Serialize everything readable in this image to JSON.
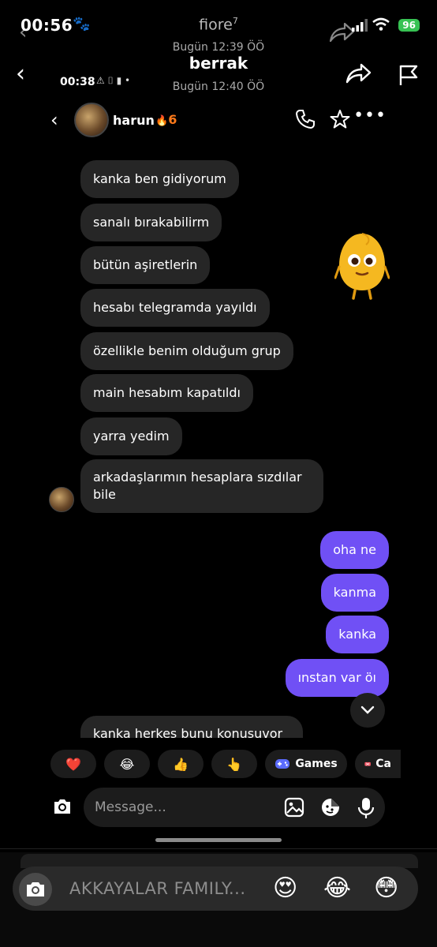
{
  "outer_status": {
    "time": "00:56",
    "paw_icon": "🐾",
    "app_name": "fiore",
    "app_sup": "7",
    "sub_time": "Bugün 12:39 ÖÖ",
    "battery": "96"
  },
  "story_header": {
    "title": "berrak",
    "subtitle": "Bugün 12:40 ÖÖ"
  },
  "inner_status": {
    "time": "00:38",
    "icons": "⚠ ⌷ ▮ •"
  },
  "chat": {
    "contact_name": "harun",
    "streak_icon": "🔥",
    "streak": "6",
    "more_icon": "•••"
  },
  "messages": [
    {
      "text": "kanka ben gidiyorum",
      "side": "left"
    },
    {
      "text": "sanalı bırakabilirm",
      "side": "left"
    },
    {
      "text": "bütün aşiretlerin",
      "side": "left"
    },
    {
      "text": "hesabı telegramda yayıldı",
      "side": "left"
    },
    {
      "text": "özellikle benim olduğum grup",
      "side": "left"
    },
    {
      "text": "main hesabım kapatıldı",
      "side": "left"
    },
    {
      "text": "yarra yedim",
      "side": "left"
    },
    {
      "text": "arkadaşlarımın hesaplara sızdılar bile",
      "side": "left"
    },
    {
      "text": "oha ne",
      "side": "right"
    },
    {
      "text": "kanma",
      "side": "right"
    },
    {
      "text": "kanka",
      "side": "right"
    },
    {
      "text": "ınstan var öı",
      "side": "right"
    },
    {
      "text": "kanka herkes bunu konusuvor",
      "side": "left"
    }
  ],
  "quick_reactions": [
    "❤️",
    "😂",
    "👍",
    "👆"
  ],
  "chips": {
    "games_label": "Games",
    "cut_label": "Ca"
  },
  "composer": {
    "placeholder": "Message..."
  },
  "outer_reply": {
    "placeholder": "AKKAYALAR FAMILY...",
    "emojis": [
      "😍",
      "😂",
      "😳"
    ]
  },
  "colors": {
    "accent_purple": "#7050f5",
    "bubble_gray": "#262626",
    "streak_orange": "#ff7a1a",
    "battery_green": "#37c253"
  }
}
